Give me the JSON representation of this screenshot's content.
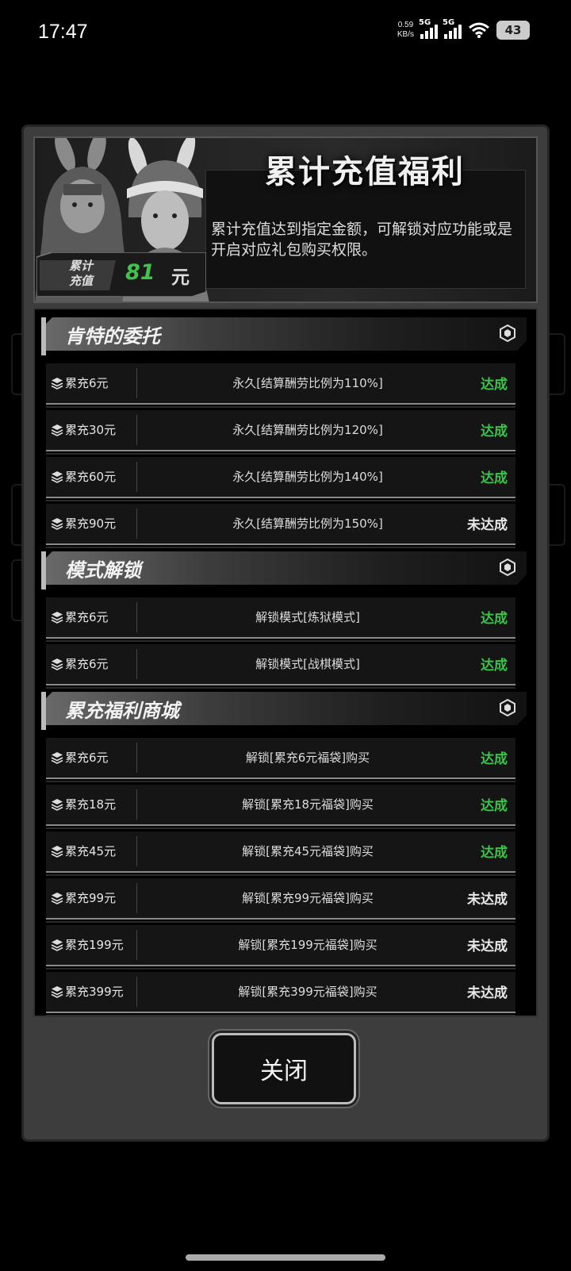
{
  "status_bar": {
    "time": "17:47",
    "speed_value": "0.59",
    "speed_unit": "KB/s",
    "sim1": "5G",
    "sim2": "5G",
    "battery": "43"
  },
  "header": {
    "title": "累计充值福利",
    "description": "累计充值达到指定金额，可解锁对应功能或是开启对应礼包购买权限。",
    "total_label_line1": "累计",
    "total_label_line2": "充值",
    "total_value": "81",
    "total_unit": "元"
  },
  "sections": [
    {
      "title": "肯特的委托",
      "rows": [
        {
          "req": "累充6元",
          "reward": "永久[结算酬劳比例为110%]",
          "status": "达成",
          "done": true
        },
        {
          "req": "累充30元",
          "reward": "永久[结算酬劳比例为120%]",
          "status": "达成",
          "done": true
        },
        {
          "req": "累充60元",
          "reward": "永久[结算酬劳比例为140%]",
          "status": "达成",
          "done": true
        },
        {
          "req": "累充90元",
          "reward": "永久[结算酬劳比例为150%]",
          "status": "未达成",
          "done": false
        }
      ]
    },
    {
      "title": "模式解锁",
      "rows": [
        {
          "req": "累充6元",
          "reward": "解锁模式[炼狱模式]",
          "status": "达成",
          "done": true
        },
        {
          "req": "累充6元",
          "reward": "解锁模式[战棋模式]",
          "status": "达成",
          "done": true
        }
      ]
    },
    {
      "title": "累充福利商城",
      "rows": [
        {
          "req": "累充6元",
          "reward": "解锁[累充6元福袋]购买",
          "status": "达成",
          "done": true
        },
        {
          "req": "累充18元",
          "reward": "解锁[累充18元福袋]购买",
          "status": "达成",
          "done": true
        },
        {
          "req": "累充45元",
          "reward": "解锁[累充45元福袋]购买",
          "status": "达成",
          "done": true
        },
        {
          "req": "累充99元",
          "reward": "解锁[累充99元福袋]购买",
          "status": "未达成",
          "done": false
        },
        {
          "req": "累充199元",
          "reward": "解锁[累充199元福袋]购买",
          "status": "未达成",
          "done": false
        },
        {
          "req": "累充399元",
          "reward": "解锁[累充399元福袋]购买",
          "status": "未达成",
          "done": false
        }
      ]
    }
  ],
  "close_label": "关闭",
  "colors": {
    "achieved": "#39c447",
    "not_achieved": "#e8e8e8",
    "total_value": "#3fc34a"
  }
}
